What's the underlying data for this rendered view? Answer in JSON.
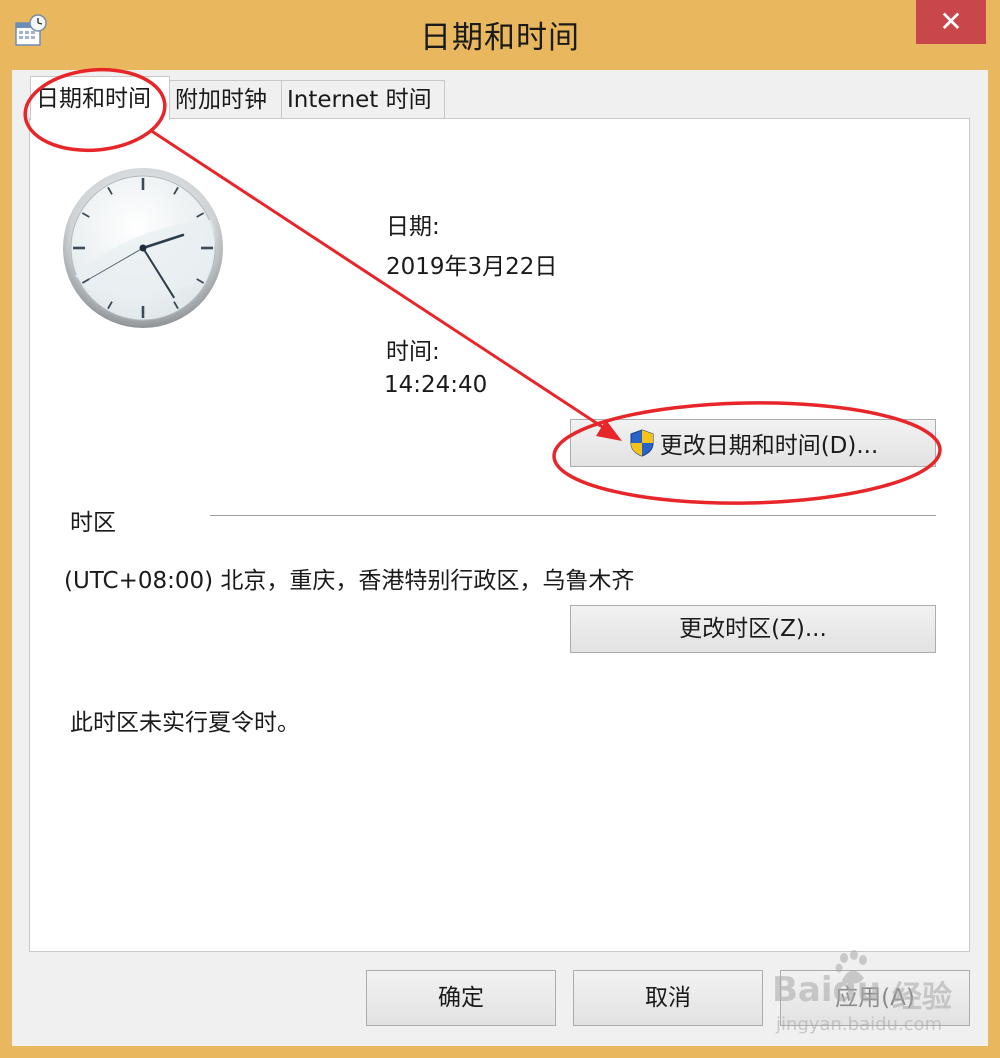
{
  "window": {
    "title": "日期和时间",
    "close_glyph": "✕"
  },
  "tabs": [
    {
      "label": "日期和时间"
    },
    {
      "label": "附加时钟"
    },
    {
      "label": "Internet 时间"
    }
  ],
  "date": {
    "label": "日期:",
    "value": "2019年3月22日"
  },
  "time": {
    "label": "时间:",
    "value": "14:24:40"
  },
  "change_datetime_button": {
    "label": "更改日期和时间(D)...",
    "icon": "uac-shield-icon"
  },
  "timezone": {
    "heading": "时区",
    "value": "(UTC+08:00) 北京，重庆，香港特别行政区，乌鲁木齐",
    "change_button": "更改时区(Z)...",
    "dst_note": "此时区未实行夏令时。"
  },
  "footer": {
    "ok": "确定",
    "cancel": "取消",
    "apply": "应用(A)"
  },
  "clock": {
    "hour": 14,
    "minute": 24,
    "second": 40
  },
  "watermark": {
    "brand": "Baidu",
    "brand_cn": "经验",
    "url": "jingyan.baidu.com"
  },
  "colors": {
    "frame": "#e9b85e",
    "close_button": "#c9474a",
    "annotation": "#e8262a",
    "shield_blue": "#2a63c8",
    "shield_yellow": "#f3c31a"
  }
}
